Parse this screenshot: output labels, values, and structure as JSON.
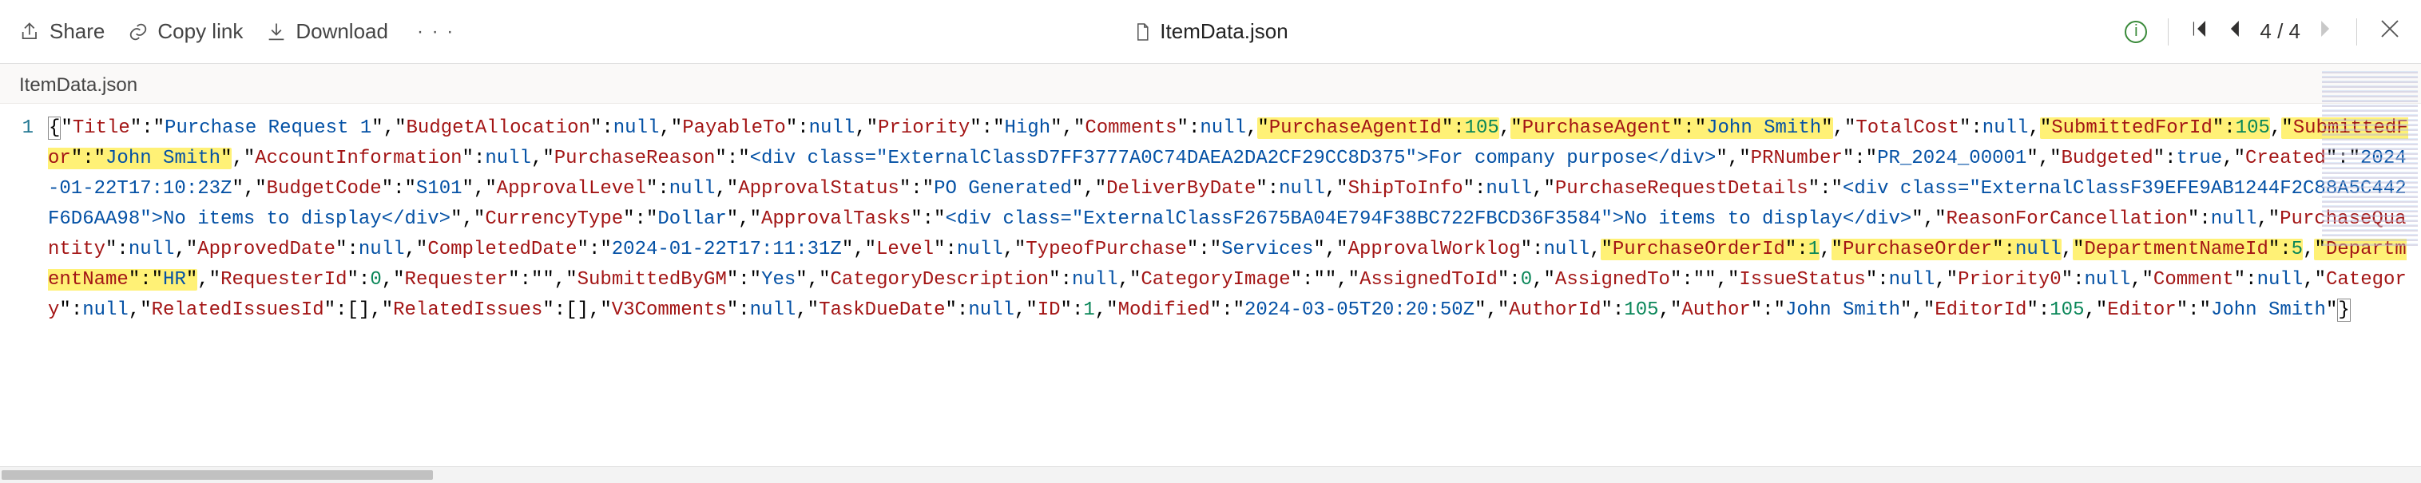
{
  "toolbar": {
    "share_label": "Share",
    "copy_label": "Copy link",
    "download_label": "Download",
    "filename": "ItemData.json",
    "pager": "4 / 4"
  },
  "tab": {
    "label": "ItemData.json"
  },
  "gutter_line": "1",
  "json_content": {
    "Title": "Purchase Request 1",
    "BudgetAllocation": null,
    "PayableTo": null,
    "Priority": "High",
    "Comments": null,
    "PurchaseAgentId": 105,
    "PurchaseAgent": "John Smith",
    "TotalCost": null,
    "SubmittedForId": 105,
    "SubmittedFor": "John Smith",
    "AccountInformation": null,
    "PurchaseReason": "<div class=\"ExternalClassD7FF3777A0C74DAEA2DA2CF29CC8D375\">For company purpose</div>",
    "PRNumber": "PR_2024_00001",
    "Budgeted": true,
    "Created": "2024-01-22T17:10:23Z",
    "BudgetCode": "S101",
    "ApprovalLevel": null,
    "ApprovalStatus": "PO Generated",
    "DeliverByDate": null,
    "ShipToInfo": null,
    "PurchaseRequestDetails": "<div class=\"ExternalClassF39EFE9AB1244F2C88A5C442F6D6AA98\">No items to display</div>",
    "CurrencyType": "Dollar",
    "ApprovalTasks": "<div class=\"ExternalClassF2675BA04E794F38BC722FBCD36F3584\">No items to display</div>",
    "ReasonForCancellation": null,
    "PurchaseQuantity": null,
    "ApprovedDate": null,
    "CompletedDate": "2024-01-22T17:11:31Z",
    "Level": null,
    "TypeofPurchase": "Services",
    "ApprovalWorklog": null,
    "PurchaseOrderId": 1,
    "PurchaseOrder": null,
    "DepartmentNameId": 5,
    "DepartmentName": "HR",
    "RequesterId": 0,
    "Requester": "",
    "SubmittedByGM": "Yes",
    "CategoryDescription": null,
    "CategoryImage": "",
    "AssignedToId": 0,
    "AssignedTo": "",
    "IssueStatus": null,
    "Priority0": null,
    "Comment": null,
    "Category": null,
    "RelatedIssuesId": [],
    "RelatedIssues": [],
    "V3Comments": null,
    "TaskDueDate": null,
    "ID": 1,
    "Modified": "2024-03-05T20:20:50Z",
    "AuthorId": 105,
    "Author": "John Smith",
    "EditorId": 105,
    "Editor": "John Smith"
  },
  "highlighted_keys": [
    "PurchaseAgentId",
    "PurchaseAgent",
    "SubmittedForId",
    "SubmittedFor",
    "PurchaseOrderId",
    "PurchaseOrder",
    "DepartmentNameId",
    "DepartmentName"
  ]
}
